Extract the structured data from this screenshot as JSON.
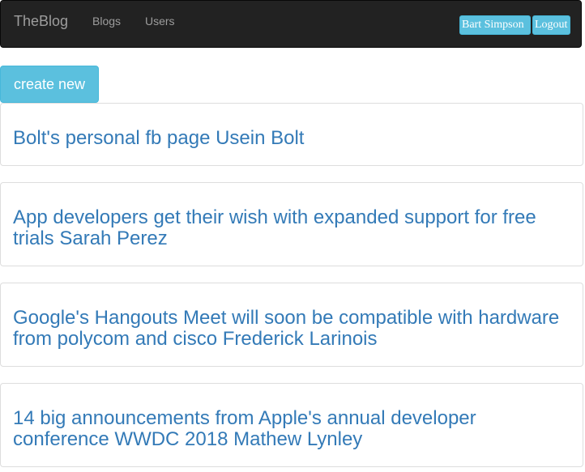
{
  "navbar": {
    "brand": "TheBlog",
    "links": [
      "Blogs",
      "Users"
    ],
    "user_button": "Bart Simpson",
    "logout_button": "Logout"
  },
  "actions": {
    "create_new": "create new"
  },
  "blogs": [
    {
      "text": "Bolt's personal fb page Usein Bolt"
    },
    {
      "text": "App developers get their wish with expanded support for free trials Sarah Perez"
    },
    {
      "text": "Google's Hangouts Meet will soon be compatible with hardware from polycom and cisco Frederick Larinois"
    },
    {
      "text": "14 big announcements from Apple's annual developer conference WWDC 2018 Mathew Lynley"
    }
  ],
  "colors": {
    "navbar_bg": "#222222",
    "nav_text": "#9d9d9d",
    "info_button": "#5bc0de",
    "link": "#337ab7"
  }
}
